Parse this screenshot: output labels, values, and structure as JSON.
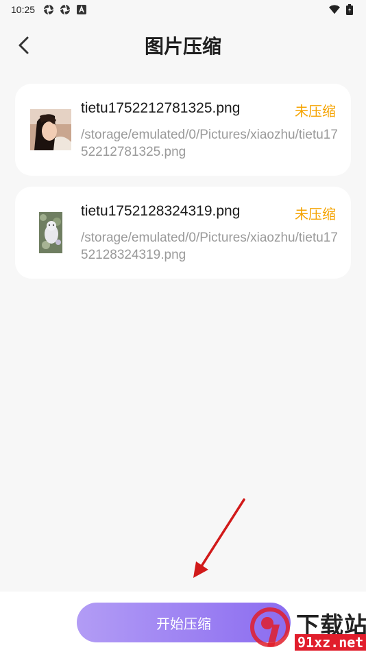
{
  "status_bar": {
    "time": "10:25",
    "icons_left": [
      "aperture-icon",
      "aperture-icon",
      "font-a-icon"
    ],
    "icons_right": [
      "wifi-icon",
      "battery-icon"
    ]
  },
  "header": {
    "back_icon": "chevron-left-icon",
    "title": "图片压缩"
  },
  "files": [
    {
      "name": "tietu1752212781325.png",
      "status": "未压缩",
      "path": "/storage/emulated/0/Pictures/xiaozhu/tietu1752212781325.png",
      "thumb": "portrait-photo"
    },
    {
      "name": "tietu1752128324319.png",
      "status": "未压缩",
      "path": "/storage/emulated/0/Pictures/xiaozhu/tietu1752128324319.png",
      "thumb": "cat-photo"
    }
  ],
  "start_button": {
    "label": "开始压缩"
  },
  "watermark": {
    "brand": "下载站",
    "domain": "91xz.net"
  },
  "colors": {
    "accent_orange": "#f5a300",
    "button_gradient_start": "#b29cf5",
    "button_gradient_end": "#8b6cf0",
    "annotation_red": "#e11e2c"
  }
}
